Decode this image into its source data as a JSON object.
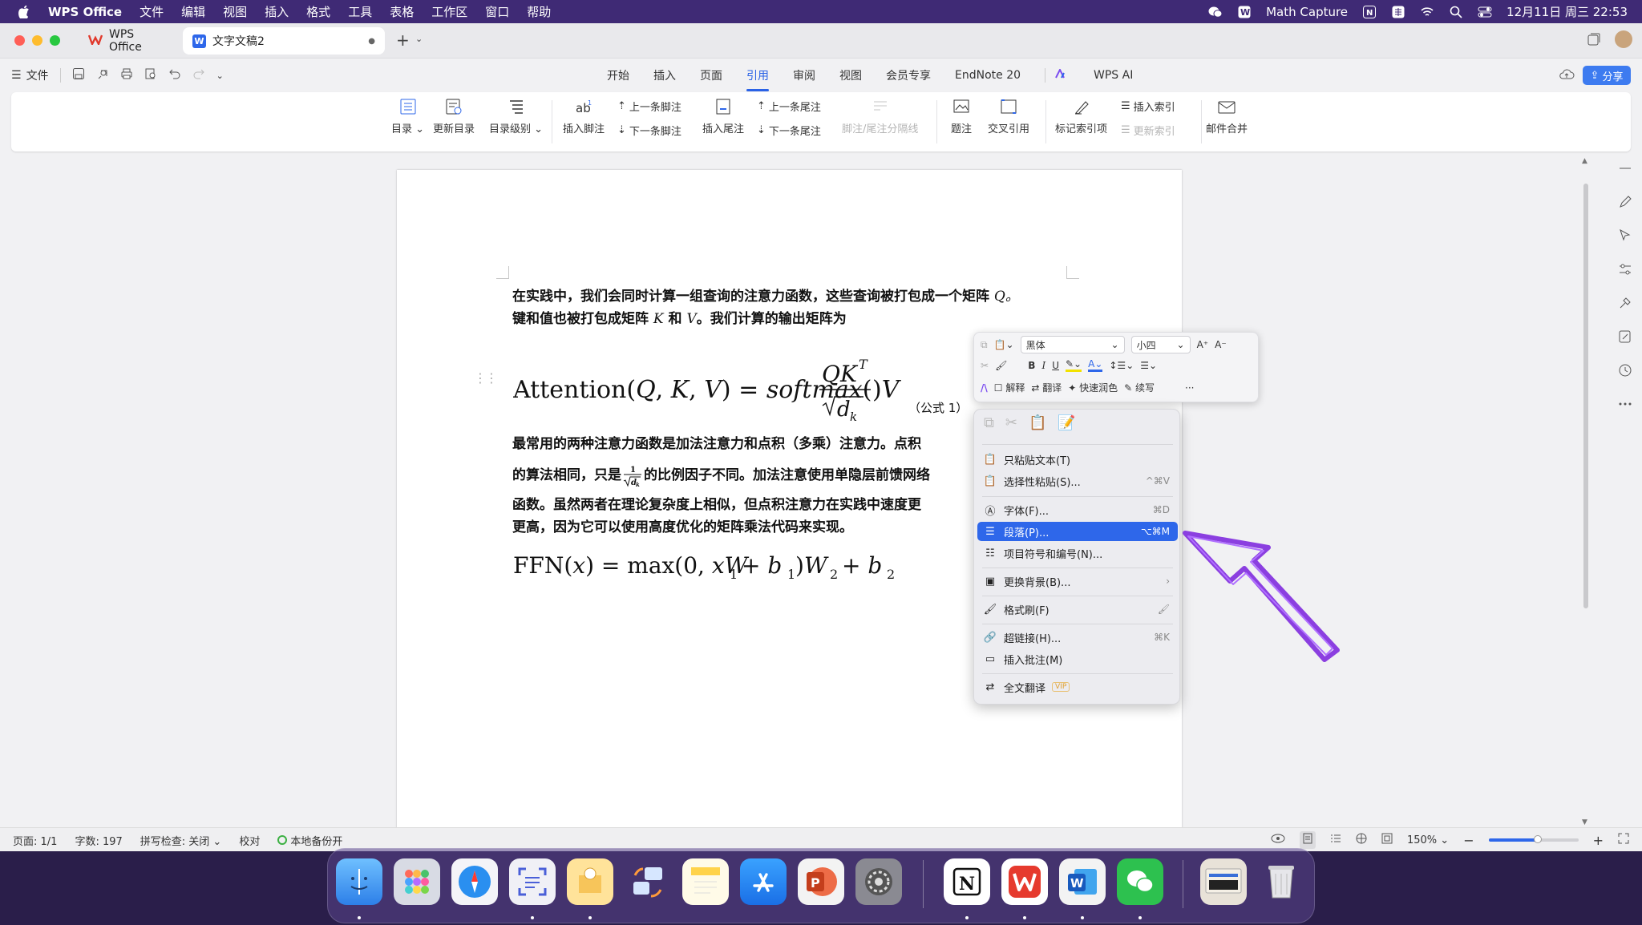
{
  "menubar": {
    "app": "WPS Office",
    "items": [
      "文件",
      "编辑",
      "视图",
      "插入",
      "格式",
      "工具",
      "表格",
      "工作区",
      "窗口",
      "帮助"
    ],
    "capture": "Math Capture",
    "datetime": "12月11日 周三 22:53"
  },
  "tabs": {
    "home": "WPS Office",
    "doc": "文字文稿2"
  },
  "toolbar": {
    "file": "文件",
    "menu_tabs": [
      "开始",
      "插入",
      "页面",
      "引用",
      "审阅",
      "视图",
      "会员专享",
      "EndNote 20"
    ],
    "active_tab": "引用",
    "ai": "WPS AI",
    "share": "分享"
  },
  "ribbon": {
    "toc": "目录",
    "update_toc": "更新目录",
    "toc_level": "目录级别",
    "insert_footnote": "插入脚注",
    "prev_footnote": "上一条脚注",
    "next_footnote": "下一条脚注",
    "insert_endnote": "插入尾注",
    "prev_endnote": "上一条尾注",
    "next_endnote": "下一条尾注",
    "separator": "脚注/尾注分隔线",
    "caption": "题注",
    "cross_ref": "交叉引用",
    "mark_index": "标记索引项",
    "insert_index": "插入索引",
    "update_index": "更新索引",
    "mail_merge": "邮件合并"
  },
  "document": {
    "p1_line1": "在实践中，我们会同时计算一组查询的注意力函数，这些查询被打包成一个矩阵",
    "p1_line1_var": "Q。",
    "p1_line2a": "键和值也被打包成矩阵",
    "p1_line2_k": "K",
    "p1_line2_and": "和",
    "p1_line2_v": "V",
    "p1_line2b": "。我们计算的输出矩阵为",
    "eq1_label": "（公式 1）",
    "p2_line1": "最常用的两种注意力函数是加法注意力和点积（多乘）注意力。点积",
    "p2_line2a": "的算法相同，只是",
    "p2_line2b": "的比例因子不同。加法注意使用单隐层前馈网络",
    "p2_line3": "函数。虽然两者在理论复杂度上相似，但点积注意力在实践中速度更",
    "p2_line4": "更高，因为它可以使用高度优化的矩阵乘法代码来实现。"
  },
  "mini_toolbar": {
    "font": "黑体",
    "size": "小四",
    "explain": "解释",
    "translate": "翻译",
    "polish": "快速润色",
    "continue": "续写"
  },
  "context_menu": {
    "items": [
      {
        "label": "只粘贴文本(T)",
        "shortcut": ""
      },
      {
        "label": "选择性粘贴(S)...",
        "shortcut": "^⌘V"
      },
      {
        "label": "字体(F)...",
        "shortcut": "⌘D"
      },
      {
        "label": "段落(P)...",
        "shortcut": "⌥⌘M"
      },
      {
        "label": "项目符号和编号(N)...",
        "shortcut": ""
      },
      {
        "label": "更换背景(B)...",
        "shortcut": "›"
      },
      {
        "label": "格式刷(F)",
        "shortcut": ""
      },
      {
        "label": "超链接(H)...",
        "shortcut": "⌘K"
      },
      {
        "label": "插入批注(M)",
        "shortcut": ""
      },
      {
        "label": "全文翻译",
        "shortcut": ""
      }
    ],
    "vip": "VIP"
  },
  "statusbar": {
    "page": "页面: 1/1",
    "words": "字数: 197",
    "spell": "拼写检查: 关闭",
    "proof": "校对",
    "backup": "本地备份开",
    "zoom": "150%"
  },
  "colors": {
    "menubar": "#3f2a75",
    "accent": "#2e67ea",
    "arrow": "#8b3fe0"
  },
  "icons": [
    "apple-icon",
    "wechat-icon",
    "search-icon",
    "control-center-icon",
    "share-icon",
    "cloud-icon",
    "pen-icon",
    "cursor-icon",
    "settings-icon",
    "history-icon",
    "more-icon"
  ]
}
